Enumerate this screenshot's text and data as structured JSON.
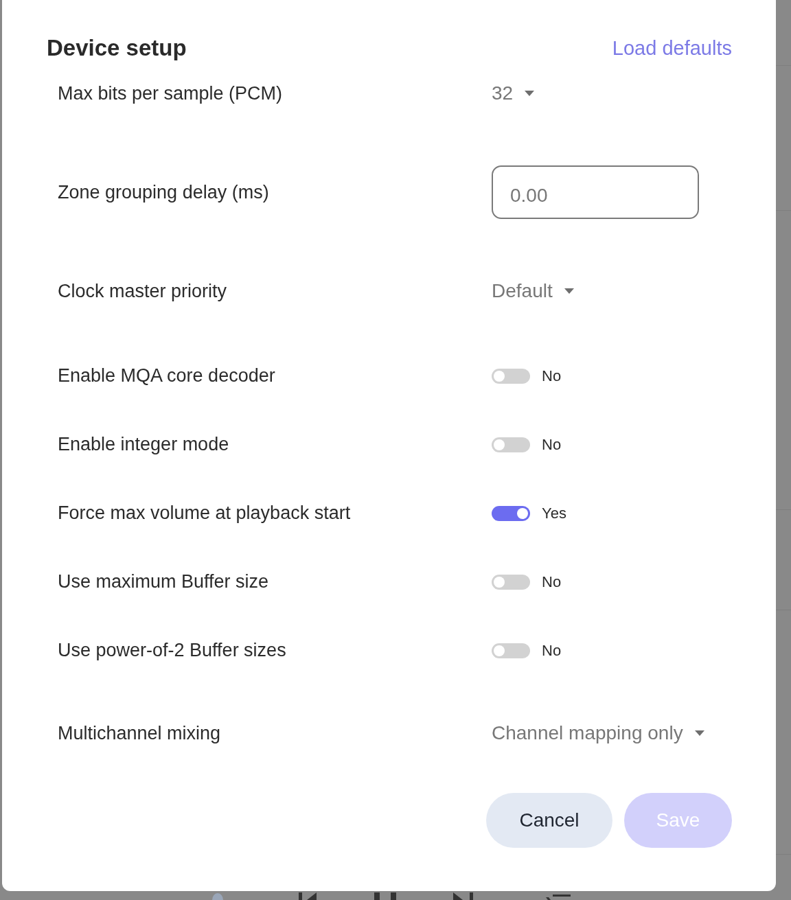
{
  "dialog": {
    "title": "Device setup",
    "load_defaults_link": "Load defaults",
    "settings": [
      {
        "kind": "dropdown",
        "label": "Max bits per sample (PCM)",
        "value": "32"
      },
      {
        "kind": "number",
        "label": "Zone grouping delay (ms)",
        "value": "0.00"
      },
      {
        "kind": "dropdown",
        "label": "Clock master priority",
        "value": "Default"
      },
      {
        "kind": "toggle",
        "label": "Enable MQA core decoder",
        "on": false,
        "state_text": "No"
      },
      {
        "kind": "toggle",
        "label": "Enable integer mode",
        "on": false,
        "state_text": "No"
      },
      {
        "kind": "toggle",
        "label": "Force max volume at playback start",
        "on": true,
        "state_text": "Yes"
      },
      {
        "kind": "toggle",
        "label": "Use maximum Buffer size",
        "on": false,
        "state_text": "No"
      },
      {
        "kind": "toggle",
        "label": "Use power-of-2 Buffer sizes",
        "on": false,
        "state_text": "No"
      },
      {
        "kind": "dropdown",
        "label": "Multichannel mixing",
        "value": "Channel mapping only"
      }
    ],
    "buttons": [
      {
        "kind": "secondary",
        "label": "Cancel",
        "disabled": false
      },
      {
        "kind": "primary",
        "label": "Save",
        "disabled": true
      }
    ]
  }
}
